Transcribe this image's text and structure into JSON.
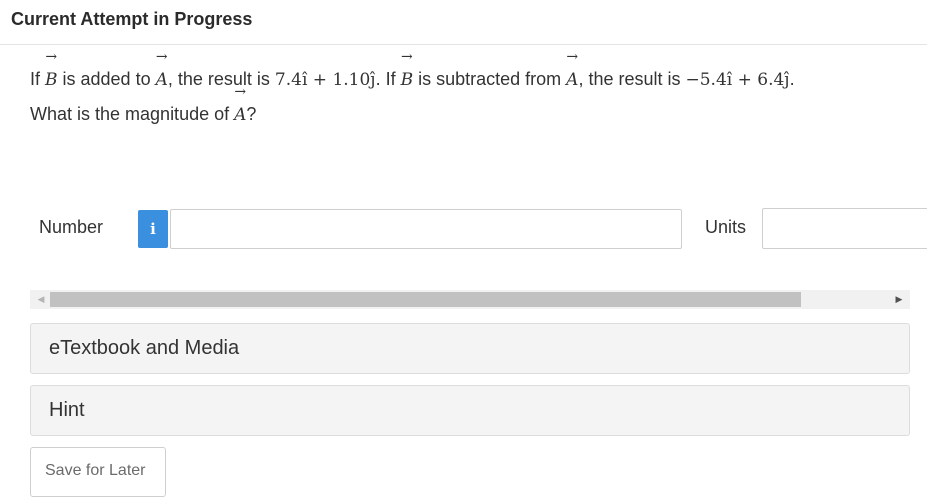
{
  "header": {
    "title": "Current Attempt in Progress"
  },
  "question": {
    "p1": "If ",
    "vecB": "B",
    "p2": " is added to ",
    "vecA": "A",
    "p3": ", the result is ",
    "sum_expr": "7.4î + 1.10ĵ",
    "p4": ". If ",
    "p5": " is subtracted from ",
    "p6": ", the result is ",
    "diff_expr": "−5.4î + 6.4ĵ",
    "p7": ".",
    "line2_prefix": "What is the magnitude of ",
    "line2_suffix": "?"
  },
  "answer": {
    "number_label": "Number",
    "info_icon": "i",
    "number_value": "",
    "units_label": "Units",
    "units_value": ""
  },
  "panels": {
    "etextbook_label": "eTextbook and Media",
    "hint_label": "Hint"
  },
  "actions": {
    "save_label": "Save for Later"
  }
}
